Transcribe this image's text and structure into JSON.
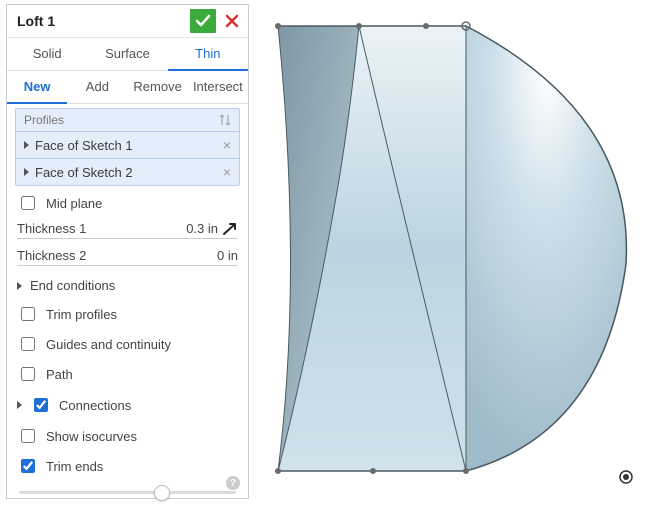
{
  "header": {
    "title": "Loft 1"
  },
  "tabs": [
    {
      "label": "Solid",
      "active": false
    },
    {
      "label": "Surface",
      "active": false
    },
    {
      "label": "Thin",
      "active": true
    }
  ],
  "subtabs": [
    {
      "label": "New",
      "active": true
    },
    {
      "label": "Add",
      "active": false
    },
    {
      "label": "Remove",
      "active": false
    },
    {
      "label": "Intersect",
      "active": false
    }
  ],
  "profiles": {
    "header": "Profiles",
    "items": [
      {
        "label": "Face of Sketch 1"
      },
      {
        "label": "Face of Sketch 2"
      }
    ]
  },
  "thickness1": {
    "label": "Thickness 1",
    "value": "0.3 in"
  },
  "thickness2": {
    "label": "Thickness 2",
    "value": "0 in"
  },
  "options": {
    "mid_plane": {
      "label": "Mid plane",
      "checked": false
    },
    "end_conditions": {
      "label": "End conditions"
    },
    "trim_profiles": {
      "label": "Trim profiles",
      "checked": false
    },
    "guides": {
      "label": "Guides and continuity",
      "checked": false
    },
    "path": {
      "label": "Path",
      "checked": false
    },
    "connections": {
      "label": "Connections",
      "checked": true
    },
    "show_isocurves": {
      "label": "Show isocurves",
      "checked": false
    },
    "trim_ends": {
      "label": "Trim ends",
      "checked": true
    }
  }
}
